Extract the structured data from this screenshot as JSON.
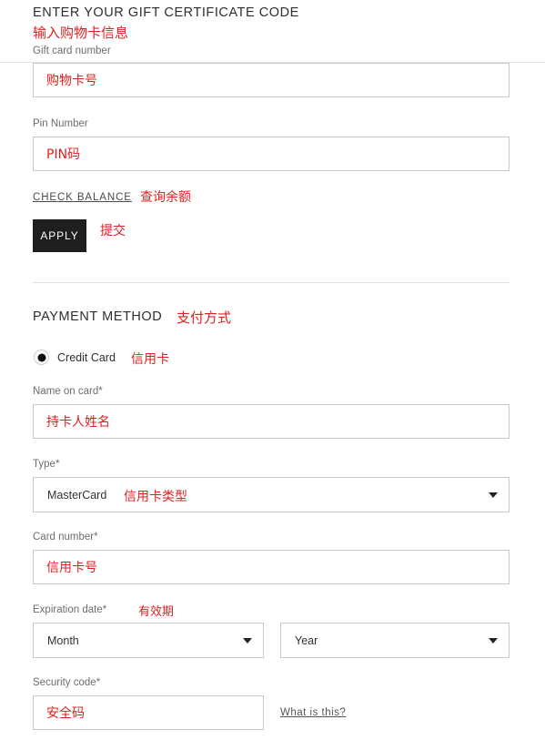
{
  "gift_certificate": {
    "heading": "ENTER YOUR GIFT CERTIFICATE CODE",
    "heading_cn": "输入购物卡信息",
    "card_number_label": "Gift card number",
    "card_number_placeholder_cn": "购物卡号",
    "pin_label": "Pin Number",
    "pin_placeholder_cn": "PIN码",
    "check_balance_link": "CHECK BALANCE",
    "check_balance_cn": "查询余额",
    "apply_button": "APPLY",
    "apply_cn": "提交"
  },
  "payment_method": {
    "heading": "PAYMENT METHOD",
    "heading_cn": "支付方式",
    "credit_card_option": "Credit Card",
    "credit_card_cn": "信用卡",
    "name_on_card_label": "Name on card",
    "name_on_card_cn": "持卡人姓名",
    "type_label": "Type",
    "type_value": "MasterCard",
    "type_cn": "信用卡类型",
    "card_number_label": "Card number",
    "card_number_cn": "信用卡号",
    "expiration_label": "Expiration date",
    "expiration_cn": "有效期",
    "month_value": "Month",
    "year_value": "Year",
    "security_code_label": "Security code",
    "security_code_cn": "安全码",
    "what_is_this_link": "What is this?",
    "required_marker": "*"
  },
  "colors": {
    "annotation_red": "#e02020",
    "button_dark": "#1f1f1f",
    "field_border": "#c9c9c9",
    "divider": "#e0e0e0",
    "label_gray": "#6d6d6d"
  }
}
